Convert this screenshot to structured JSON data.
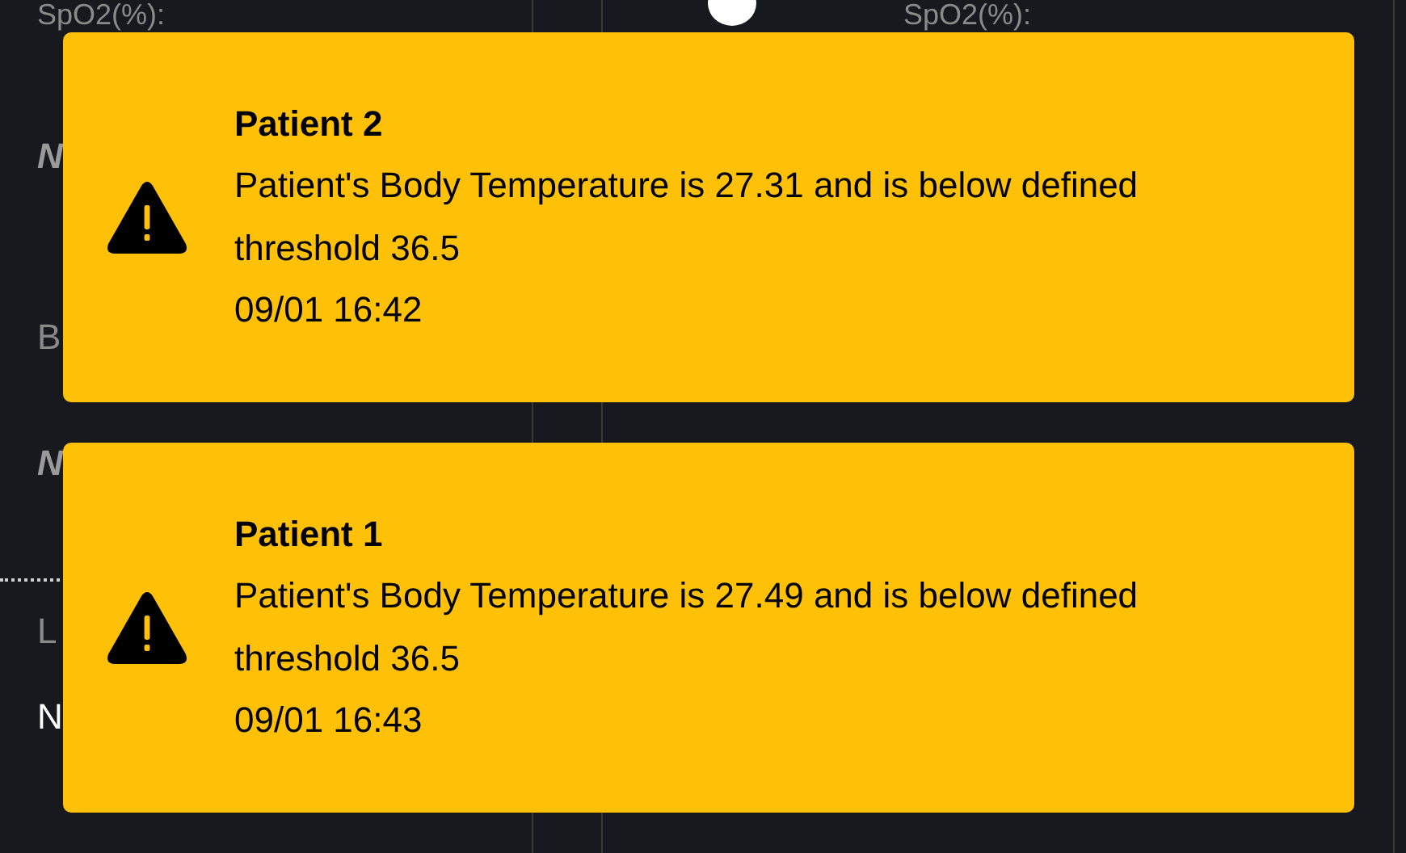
{
  "background": {
    "left_items": [
      {
        "text": "SpO2(%):",
        "kind": "label"
      },
      {
        "text": "N",
        "kind": "value"
      },
      {
        "text": "B",
        "kind": "label"
      },
      {
        "text": "N",
        "kind": "value"
      },
      {
        "text": "L",
        "kind": "label",
        "divider_above": true
      },
      {
        "text": "N",
        "kind": "current"
      }
    ],
    "right_items": [
      {
        "text": "SpO2(%):",
        "kind": "label"
      }
    ]
  },
  "notifications": [
    {
      "title": "Patient 2",
      "message": "Patient's Body Temperature is 27.31 and is below defined threshold 36.5",
      "time": "09/01 16:42"
    },
    {
      "title": "Patient 1",
      "message": "Patient's Body Temperature is 27.49 and is below defined threshold 36.5",
      "time": "09/01 16:43"
    }
  ]
}
